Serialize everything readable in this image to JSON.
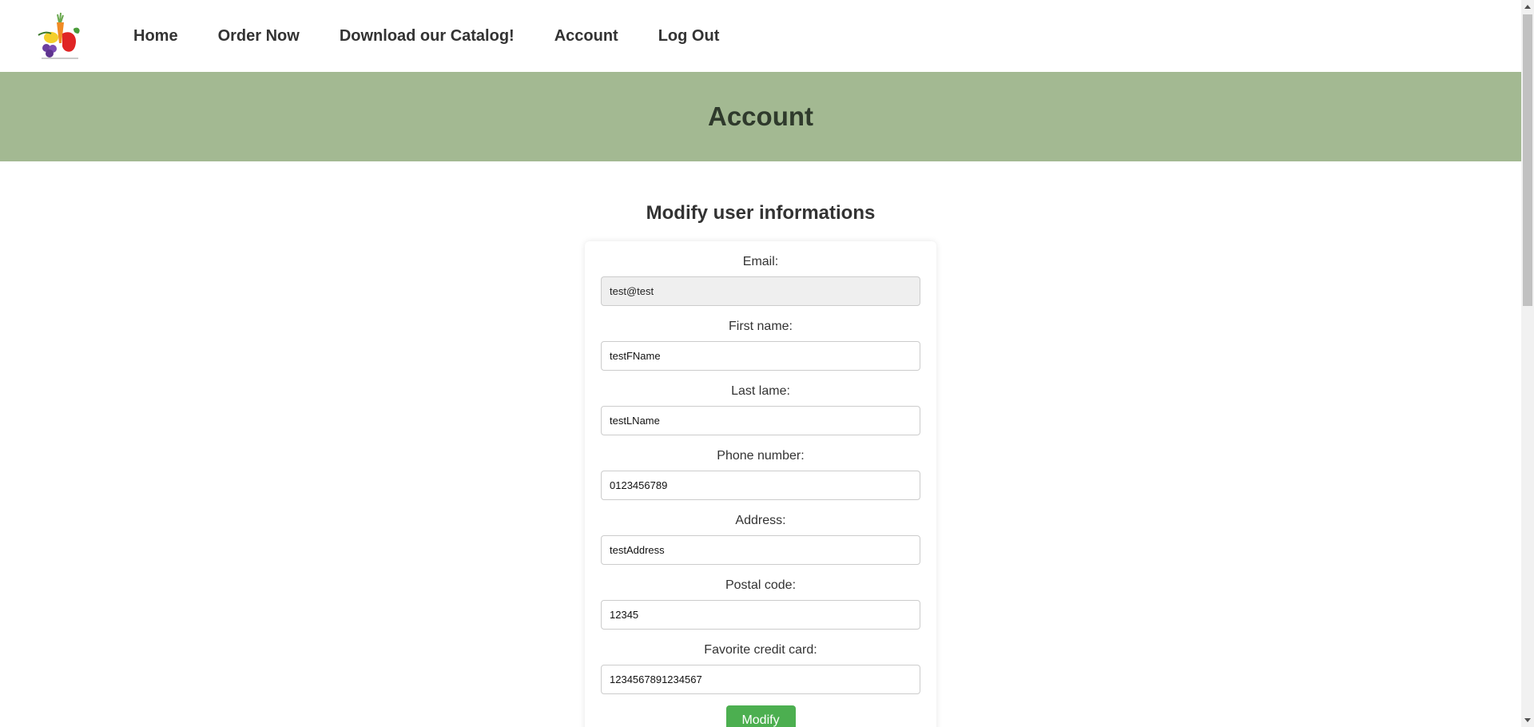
{
  "header": {
    "logo_icon": "fruit-vegetable-basket-logo",
    "nav": [
      {
        "label": "Home"
      },
      {
        "label": "Order Now"
      },
      {
        "label": "Download our Catalog!"
      },
      {
        "label": "Account"
      },
      {
        "label": "Log Out"
      }
    ]
  },
  "banner": {
    "title": "Account",
    "background_color": "#a3b992"
  },
  "main": {
    "section_title": "Modify user informations",
    "fields": [
      {
        "label": "Email:",
        "value": "test@test",
        "readonly": true
      },
      {
        "label": "First name:",
        "value": "testFName",
        "readonly": false
      },
      {
        "label": "Last lame:",
        "value": "testLName",
        "readonly": false
      },
      {
        "label": "Phone number:",
        "value": "0123456789",
        "readonly": false
      },
      {
        "label": "Address:",
        "value": "testAddress",
        "readonly": false
      },
      {
        "label": "Postal code:",
        "value": "12345",
        "readonly": false
      },
      {
        "label": "Favorite credit card:",
        "value": "1234567891234567",
        "readonly": false
      }
    ],
    "submit_label": "Modify",
    "submit_color": "#4caf50"
  },
  "scrollbar": {
    "up_icon": "scroll-up-arrow-icon",
    "down_icon": "scroll-down-arrow-icon"
  }
}
